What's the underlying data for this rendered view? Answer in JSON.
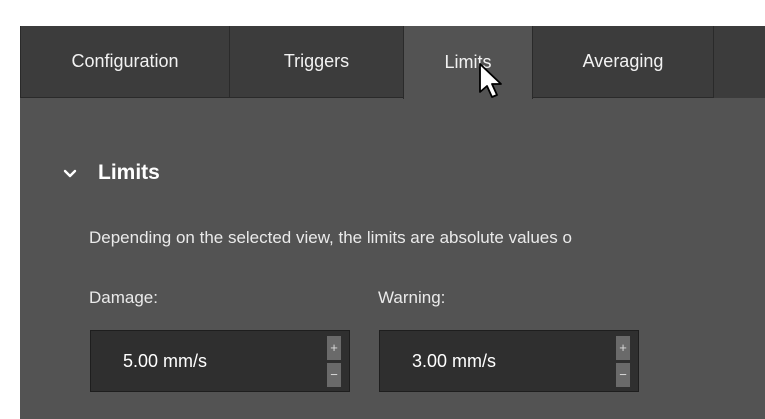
{
  "tabs": [
    {
      "label": "Configuration"
    },
    {
      "label": "Triggers"
    },
    {
      "label": "Limits",
      "active": true
    },
    {
      "label": "Averaging"
    }
  ],
  "section": {
    "title": "Limits",
    "toggle_icon": "chevron-down-icon",
    "description": "Depending on the selected view, the limits are absolute values o"
  },
  "fields": {
    "damage": {
      "label": "Damage:",
      "value": "5.00 mm/s",
      "increment": "+",
      "decrement": "−"
    },
    "warning": {
      "label": "Warning:",
      "value": "3.00 mm/s",
      "increment": "+",
      "decrement": "−"
    }
  },
  "colors": {
    "panel_bg": "#535353",
    "tab_bg": "#3c3c3c",
    "input_bg": "#2f2f2f",
    "text": "#ffffff"
  },
  "pointer_icon": "mouse-cursor-icon"
}
